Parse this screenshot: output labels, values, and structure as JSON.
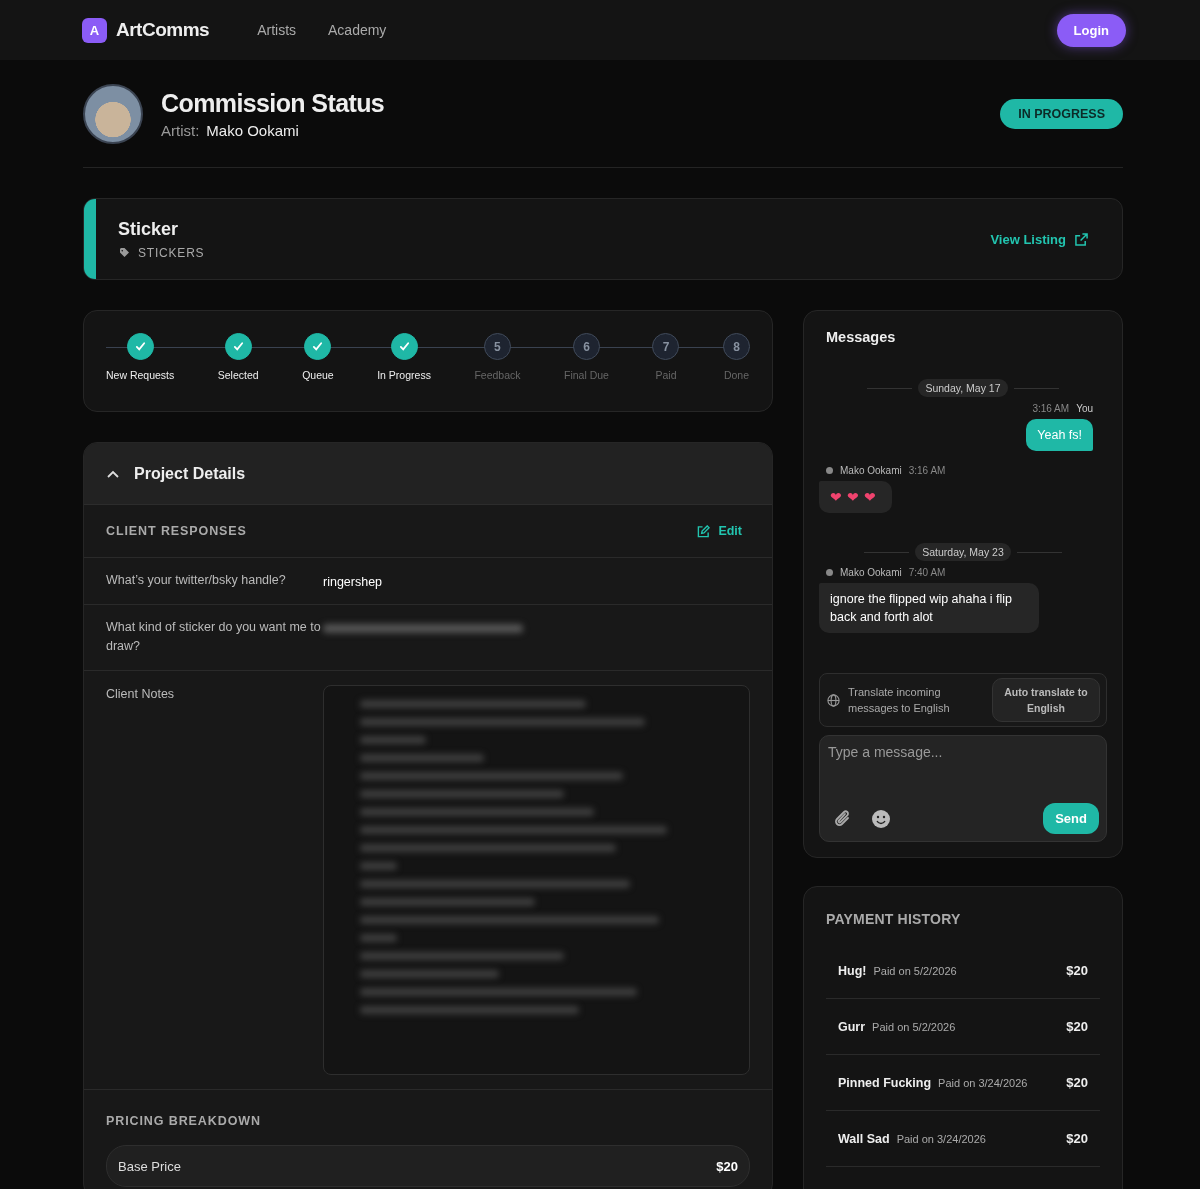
{
  "nav": {
    "logo_letter": "A",
    "brand": "ArtComms",
    "links": [
      {
        "label": "Artists"
      },
      {
        "label": "Academy"
      }
    ],
    "login": "Login"
  },
  "header": {
    "title": "Commission Status",
    "artist_label": "Artist:",
    "artist_name": "Mako Ookami",
    "status": "IN PROGRESS"
  },
  "listing": {
    "title": "Sticker",
    "category": "STICKERS",
    "link": "View Listing"
  },
  "steps": [
    {
      "label": "New Requests",
      "completed": true
    },
    {
      "label": "Selected",
      "completed": true
    },
    {
      "label": "Queue",
      "completed": true
    },
    {
      "label": "In Progress",
      "completed": true
    },
    {
      "label": "Feedback",
      "number": "5",
      "completed": false
    },
    {
      "label": "Final Due",
      "number": "6",
      "completed": false
    },
    {
      "label": "Paid",
      "number": "7",
      "completed": false
    },
    {
      "label": "Done",
      "number": "8",
      "completed": false
    }
  ],
  "project_details": {
    "title": "Project Details",
    "expanded": true,
    "responses_title": "CLIENT RESPONSES",
    "edit": "Edit",
    "responses": [
      {
        "question": "What’s your twitter/bsky handle?",
        "answer": "ringershep",
        "redacted": false
      },
      {
        "question": "What kind of sticker do you want me to draw?",
        "redacted": true
      }
    ],
    "notes_label": "Client Notes",
    "notes_redacted": true,
    "pricing_title": "PRICING BREAKDOWN",
    "pricing": [
      {
        "label": "Base Price",
        "amount": "$20"
      }
    ]
  },
  "messages": {
    "title": "Messages",
    "items": [
      {
        "kind": "date",
        "text": "Sunday, May 17"
      },
      {
        "kind": "outgoing",
        "time": "3:16 AM",
        "sender": "You",
        "text": "Yeah fs!",
        "emoji_only": false
      },
      {
        "kind": "incoming",
        "sender": "Mako Ookami",
        "time": "3:16 AM",
        "text": "❤❤❤",
        "emoji_only": true
      },
      {
        "kind": "date",
        "text": "Saturday, May 23"
      },
      {
        "kind": "incoming",
        "sender": "Mako Ookami",
        "time": "7:40 AM",
        "text": "ignore the flipped wip ahaha i flip back and forth alot",
        "emoji_only": false
      }
    ],
    "translate": {
      "text": "Translate incoming messages to English",
      "button": "Auto translate to English"
    },
    "composer": {
      "placeholder": "Type a message...",
      "send": "Send"
    }
  },
  "payments": {
    "title": "PAYMENT HISTORY",
    "items": [
      {
        "name": "Hug!",
        "date": "Paid on 5/2/2026",
        "amount": "$20"
      },
      {
        "name": "Gurr",
        "date": "Paid on 5/2/2026",
        "amount": "$20"
      },
      {
        "name": "Pinned Fucking",
        "date": "Paid on 3/24/2026",
        "amount": "$20"
      },
      {
        "name": "Wall Sad",
        "date": "Paid on 3/24/2026",
        "amount": "$20"
      }
    ]
  }
}
